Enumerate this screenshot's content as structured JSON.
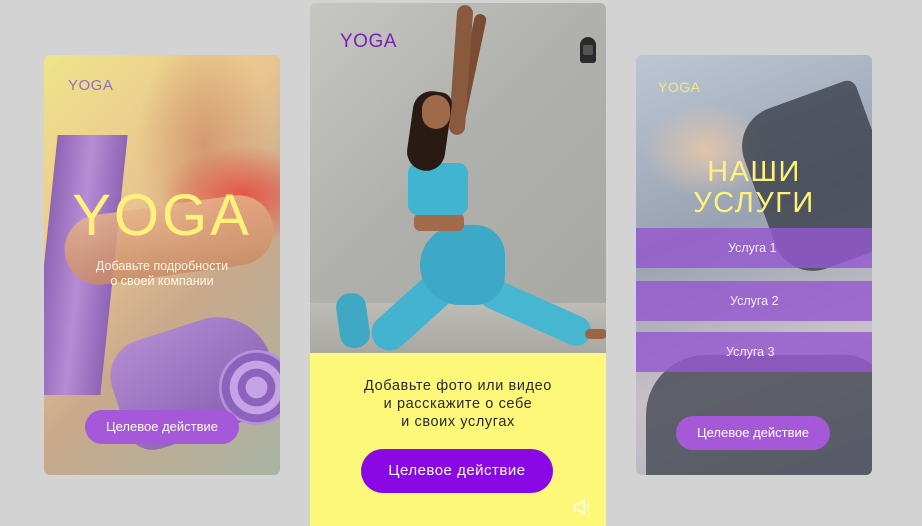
{
  "left_card": {
    "brand": "YOGA",
    "headline": "YOGA",
    "subtitle_line1": "Добавьте подробности",
    "subtitle_line2": "о своей компании",
    "cta": "Целевое действие"
  },
  "middle_card": {
    "brand": "YOGA",
    "text_line1": "Добавьте фото или видео",
    "text_line2": "и расскажите о себе",
    "text_line3": "и своих услугах",
    "cta": "Целевое действие",
    "sound_icon": "speaker-icon"
  },
  "right_card": {
    "brand": "YOGA",
    "heading_line1": "НАШИ",
    "heading_line2": "УСЛУГИ",
    "services": [
      "Услуга 1",
      "Услуга 2",
      "Услуга 3"
    ],
    "cta": "Целевое действие"
  },
  "colors": {
    "background": "#d3d3d3",
    "accent_purple": "#8a07e6",
    "button_lilac": "#a559d8",
    "highlight_yellow": "#fdf77a"
  }
}
